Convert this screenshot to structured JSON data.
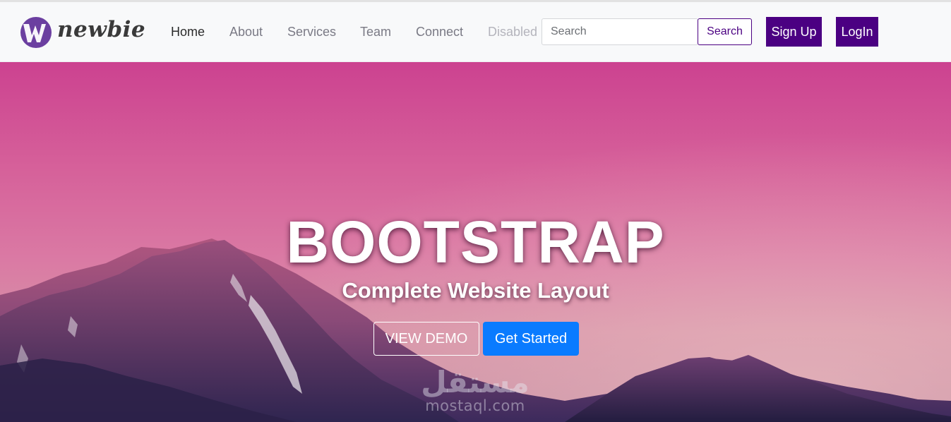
{
  "brand": {
    "logo_monogram": "W3",
    "name": "newbie"
  },
  "nav": {
    "items": [
      {
        "label": "Home",
        "state": "active"
      },
      {
        "label": "About",
        "state": "normal"
      },
      {
        "label": "Services",
        "state": "normal"
      },
      {
        "label": "Team",
        "state": "normal"
      },
      {
        "label": "Connect",
        "state": "normal"
      },
      {
        "label": "Disabled",
        "state": "disabled"
      }
    ]
  },
  "search": {
    "placeholder": "Search",
    "value": "",
    "button_label": "Search"
  },
  "auth": {
    "signup_label": "Sign Up",
    "login_label": "LogIn"
  },
  "hero": {
    "title": "BOOTSTRAP",
    "subtitle": "Complete Website Layout",
    "demo_button": "VIEW DEMO",
    "start_button": "Get Started"
  },
  "watermark": {
    "arabic": "مستقل",
    "latin": "mostaql.com"
  },
  "colors": {
    "brand_purple": "#4b0082",
    "primary_blue": "#0a7bff",
    "navbar_bg": "#f8f9fa",
    "hero_sky_top": "#cc4290"
  },
  "icons": [
    "w3-logo-icon"
  ]
}
